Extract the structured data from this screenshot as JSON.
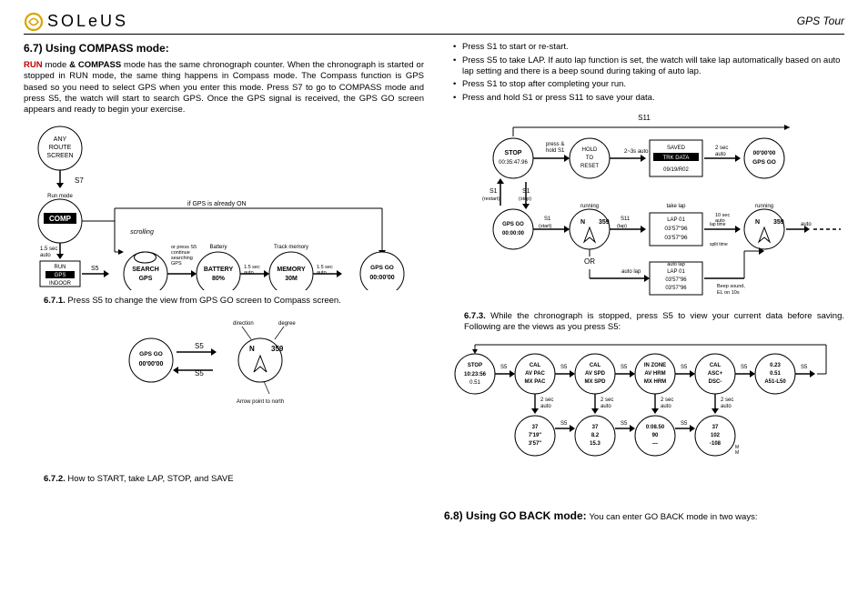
{
  "header": {
    "brand": "SOLeUS",
    "right": "GPS Tour"
  },
  "left": {
    "section_title": "6.7)  Using COMPASS mode:",
    "para1_prefix": "RUN",
    "para1_mid": " mode ",
    "para1_bold2": "& COMPASS",
    "para1_rest": " mode has the same chronograph counter. When the chronograph is started or stopped in RUN mode, the same thing happens in Compass mode. The Compass function is GPS based so you need to select GPS when you enter this mode. Press S7 to go to COMPASS mode and press S5, the watch will start to search GPS. Once the GPS signal is received, the GPS GO screen appears and ready to begin your exercise.",
    "diag1": {
      "any_route": "ANY\nROUTE\nSCREEN",
      "s7": "S7",
      "run_mode_label": "Run mode",
      "comp": "COMP",
      "one5": "1.5 sec\nauto",
      "run_gps_indoor": "RUN\nGPS\nINDOOR",
      "s5": "S5",
      "scrolling": "scrolling",
      "if_gps": "if GPS is already ON",
      "search_gps": "SEARCH\nGPS",
      "or_s5": "or press S5\ncontinue\nsearching\nGPS",
      "battery": "BATTERY\n80%",
      "battery_label": "Battery",
      "memory": "MEMORY\n30M",
      "track_memory": "Track memory",
      "gps_go": "GPS GO\n00:00:00"
    },
    "cap671_num": "6.7.1.",
    "cap671": "  Press S5 to change the view from GPS GO screen to Compass screen.",
    "diag2": {
      "gps_go": "GPS GO\n00'00'00",
      "s5": "S5",
      "direction": "direction",
      "degree": "degree",
      "compass_num": "359",
      "arrow_north": "Arrow point to north"
    },
    "cap672_num": "6.7.2.",
    "cap672": "  How to START, take LAP, STOP, and SAVE"
  },
  "right": {
    "bullets": [
      "Press S1 to start or re-start.",
      "Press S5 to take LAP. If auto lap function is set, the watch will take lap automatically based on auto lap setting and there is a beep sound during taking of auto lap.",
      "Press S1 to stop after completing your run.",
      "Press and hold S1 or press S11 to save your data."
    ],
    "diag1": {
      "s11_top": "S11",
      "stop": "STOP\n00:35:47.96",
      "press_hold": "press &\nhold S1",
      "hold_reset": "HOLD\nTO\nRESET",
      "two3s": "2~3s auto",
      "saved": "SAVED\nTRK DATA\n09/19/R02",
      "two_sec": "2 sec\nauto",
      "gps_go_zero": "00'00'00\nGPS GO",
      "s1_restart": "S1\n(restart)",
      "s1_stop": "S1\n(stop)",
      "gps_go_run": "GPS GO\n00:00:00",
      "s1_start": "S1\n(start)",
      "running": "running",
      "run359": "359",
      "s11_lap": "S11\n(lap)",
      "take_lap": "take lap",
      "lap01": "LAP 01\n03'57\"96\n03'57\"96",
      "ten_sec": "10 sec\nauto",
      "lap_time": "lap time",
      "split_time": "split time",
      "auto": "auto",
      "or": "OR",
      "auto_lap": "auto lap",
      "beep": "Beep sound,\nEL on 10s"
    },
    "cap673_num": "6.7.3.",
    "cap673": "  While the chronograph is stopped, press S5 to view your current data before saving. Following are the views as you press S5:",
    "diag2": {
      "s5": "S5",
      "two_sec": "2 sec\nauto",
      "w1": "STOP\n10:23:56\n0.51",
      "w2": "CAL\nAV PAC\nMX PAC",
      "w3": "CAL\nAV SPD\nMX SPD",
      "w4": "IN ZONE\nAV HRM\nMX HRM",
      "w5": "CAL\nASC+\nDSC-",
      "w6": "0.23\n0.51\nR51-L50",
      "w2b": "37\n7'19\"\n3'57\"",
      "w3b": "37\n8.2\n15.3",
      "w4b": "0:08.50\n90\n—",
      "w5b": "37\n102\n-108"
    },
    "section68_title": "6.8)  Using GO BACK mode:",
    "section68_rest": " You can enter GO BACK mode in two ways:"
  }
}
